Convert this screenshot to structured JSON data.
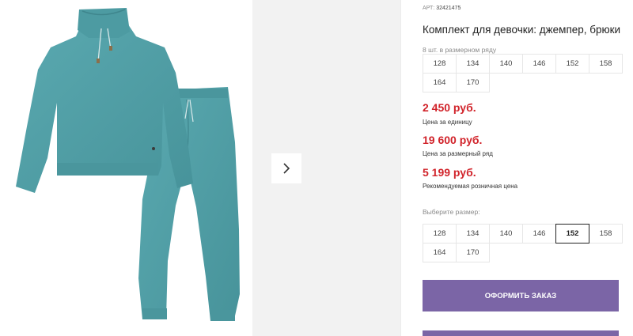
{
  "product": {
    "article_label": "АРТ:",
    "article_number": "32421475",
    "title": "Комплект для девочки: джемпер, брюки"
  },
  "size_range": {
    "note": "8 шт. в размерном ряду",
    "sizes": [
      "128",
      "134",
      "140",
      "146",
      "152",
      "158",
      "164",
      "170"
    ]
  },
  "prices": [
    {
      "value": "2 450 руб.",
      "note": "Цена за единицу"
    },
    {
      "value": "19 600 руб.",
      "note": "Цена за размерный ряд"
    },
    {
      "value": "5 199 руб.",
      "note": "Рекомендуемая розничная цена"
    }
  ],
  "size_select": {
    "label": "Выберите размер:",
    "sizes": [
      "128",
      "134",
      "140",
      "146",
      "152",
      "158",
      "164",
      "170"
    ],
    "selected": "152"
  },
  "actions": {
    "order_label": "ОФОРМИТЬ ЗАКАЗ"
  },
  "colors": {
    "price": "#d1232a",
    "button": "#7b65a6",
    "garment": "#4f9fa6"
  },
  "icons": {
    "next": "chevron-right-icon"
  }
}
